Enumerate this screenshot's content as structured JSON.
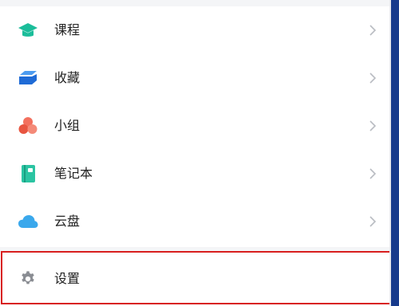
{
  "menu": {
    "items": [
      {
        "label": "课程",
        "icon": "graduation-cap-icon",
        "color": "#1bbd9a"
      },
      {
        "label": "收藏",
        "icon": "folder-icon",
        "color": "#2f7fe0"
      },
      {
        "label": "小组",
        "icon": "group-icon",
        "color": "#f0604c"
      },
      {
        "label": "笔记本",
        "icon": "notebook-icon",
        "color": "#2bc4a2"
      },
      {
        "label": "云盘",
        "icon": "cloud-icon",
        "color": "#3aa8ec"
      }
    ],
    "settings": {
      "label": "设置",
      "icon": "gear-icon",
      "color": "#8a8d93"
    }
  },
  "colors": {
    "highlight": "#d81e1e",
    "chevron": "#b9bcc2",
    "edge": "#173a8c"
  }
}
